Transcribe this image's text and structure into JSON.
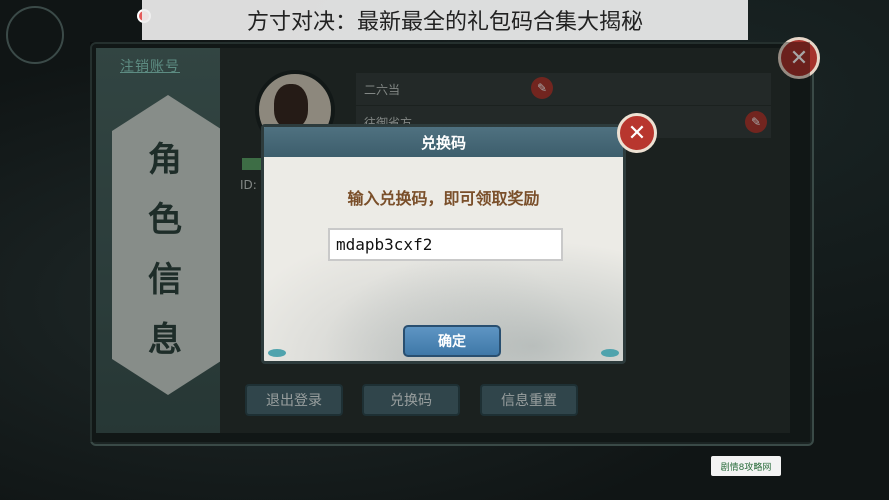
{
  "page_title": "方寸对决：最新最全的礼包码合集大揭秘",
  "profile": {
    "logout_label": "注销账号",
    "section_label": "角色信息",
    "name_field": "二六当",
    "field2": "往御省方",
    "id_label": "ID:"
  },
  "bottom_buttons": [
    "退出登录",
    "兑换码",
    "信息重置"
  ],
  "modal": {
    "title": "兑换码",
    "prompt": "输入兑换码，即可领取奖励",
    "code_value": "mdapb3cxf2",
    "confirm_label": "确定"
  },
  "close_glyph": "✕",
  "edit_glyph": "✎",
  "watermark": "剧情8攻略网"
}
